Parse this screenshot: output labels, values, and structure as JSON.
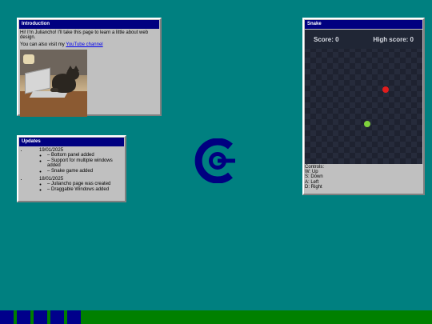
{
  "intro": {
    "title": "Introduction",
    "line1": "Hi! I'm Juliancho! I'll take this page to learn a little about web design.",
    "line2_prefix": "You can also visit my ",
    "link_text": "YouTube channel"
  },
  "updates": {
    "title": "Updates",
    "entries": [
      {
        "date": "19/01/2025",
        "items": [
          "– Bottom panel added",
          "– Support for multiple windows added",
          "– Snake game added"
        ]
      },
      {
        "date": "18/01/2025",
        "items": [
          "– Juliancho page was created",
          "– Draggable Windows added"
        ]
      }
    ]
  },
  "snake": {
    "title": "Snake",
    "score_label": "Score: 0",
    "high_score_label": "High score: 0",
    "controls": [
      "Controls:",
      "W: Up",
      "S: Down",
      "A: Left",
      "D: Right"
    ],
    "food_color": "#e21d1d",
    "snake_color": "#7fd33c"
  },
  "taskbar": {
    "color": "#008000",
    "button_color": "#00008b",
    "button_count": 5
  },
  "colors": {
    "desktop": "#008080",
    "titlebar": "#000080",
    "window": "#c0c0c0"
  },
  "logo": {
    "icon": "circle-logo-icon",
    "color": "#000080"
  }
}
